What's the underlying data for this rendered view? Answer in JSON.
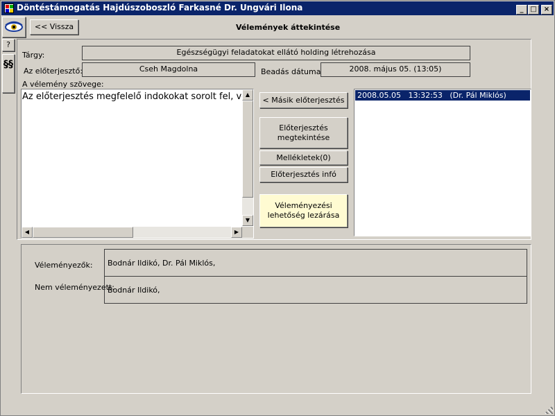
{
  "window": {
    "title": "Döntéstámogatás Hajdúszoboszló Farkasné Dr. Ungvári Ilona",
    "minimize_symbol": "_",
    "maximize_symbol": "□",
    "close_symbol": "×"
  },
  "toolbar": {
    "back_label": "<< Vissza",
    "page_title": "Vélemények áttekintése"
  },
  "sidebar": {
    "help_label": "?",
    "section_label": "§§"
  },
  "form": {
    "subject_label": "Tárgy:",
    "subject_value": "Egészségügyi feladatokat ellátó holding létrehozása",
    "submitter_label": "Az előterjesztő:",
    "submitter_value": "Cseh Magdolna",
    "date_label": "Beadás dátuma:",
    "date_value": "2008. május 05. (13:05)",
    "opinion_text_label": "A vélemény szövege:",
    "opinion_text_value": "Az előterjesztés megfelelő indokokat sorolt fel, vé"
  },
  "buttons": {
    "other_proposal": "< Másik előterjesztés",
    "view_proposal_line1": "Előterjesztés",
    "view_proposal_line2": "megtekintése",
    "attachments": "Mellékletek(0)",
    "proposal_info": "Előterjesztés infó",
    "close_opinion_line1": "Véleményezési",
    "close_opinion_line2": "lehetőség lezárása"
  },
  "opinions_list": [
    {
      "text": "2008.05.05   13:32:53   (Dr. Pál Miklós)",
      "selected": true
    }
  ],
  "summary": {
    "reviewers_label": "Véleményezők:",
    "reviewers_value": "Bodnár Ildikó, Dr. Pál Miklós,",
    "not_reviewed_label": "Nem véleményezett:",
    "not_reviewed_value": "Bodnár Ildikó,"
  },
  "colors": {
    "titlebar": "#0a246a",
    "selection": "#0a246a",
    "close_button_bg": "#fffbd2"
  }
}
